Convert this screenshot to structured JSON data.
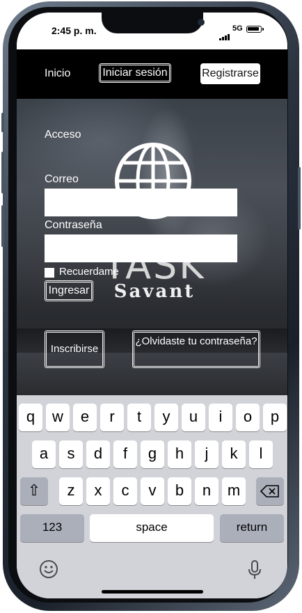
{
  "status": {
    "time": "2:45 p. m.",
    "network": "5G"
  },
  "nav": {
    "home": "Inicio",
    "login": "Iniciar sesión",
    "register": "Registrarse"
  },
  "hero": {
    "logo_text": "TASK",
    "logo_sub": "Savant"
  },
  "form": {
    "title": "Acceso",
    "email_label": "Correo",
    "email_value": "",
    "password_label": "Contraseña",
    "password_value": "",
    "remember_label": "Recuerdame",
    "submit_label": "Ingresar",
    "signup_label": "Inscribirse",
    "forgot_label": "¿Olvidaste tu contraseña?"
  },
  "keyboard": {
    "row1": [
      "q",
      "w",
      "e",
      "r",
      "t",
      "y",
      "u",
      "i",
      "o",
      "p"
    ],
    "row2": [
      "a",
      "s",
      "d",
      "f",
      "g",
      "h",
      "j",
      "k",
      "l"
    ],
    "row3": [
      "z",
      "x",
      "c",
      "v",
      "b",
      "n",
      "m"
    ],
    "shift": "⇧",
    "numbers": "123",
    "space": "space",
    "return": "return"
  },
  "icons": [
    "globe-icon",
    "signal-icon",
    "battery-icon",
    "shift-icon",
    "backspace-icon",
    "emoji-icon",
    "microphone-icon"
  ],
  "colors": {
    "navbar": "#000000",
    "keyboard_bg": "#d1d3d9",
    "key": "#ffffff",
    "key_dark": "#abafba"
  }
}
